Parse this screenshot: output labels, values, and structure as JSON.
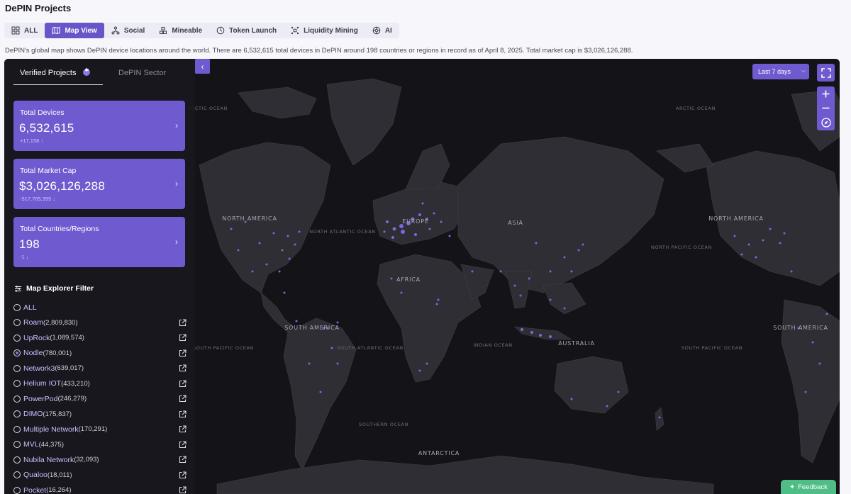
{
  "page": {
    "title": "DePIN Projects",
    "description": "DePIN's global map shows DePIN device locations around the world. There are 6,532,615 total devices in DePIN around 198 countries or regions in record as of April 8, 2025. Total market cap is $3,026,126,288."
  },
  "tabs": [
    {
      "label": "ALL",
      "icon": "grid-icon",
      "active": false
    },
    {
      "label": "Map View",
      "icon": "map-icon",
      "active": true
    },
    {
      "label": "Social",
      "icon": "network-icon",
      "active": false
    },
    {
      "label": "Mineable",
      "icon": "blocks-icon",
      "active": false
    },
    {
      "label": "Token Launch",
      "icon": "clock-icon",
      "active": false
    },
    {
      "label": "Liquidity Mining",
      "icon": "nodes-icon",
      "active": false
    },
    {
      "label": "AI",
      "icon": "ai-chip-icon",
      "active": false
    }
  ],
  "sidebar": {
    "tabs": [
      "Verified Projects",
      "DePIN Sector"
    ],
    "cards": [
      {
        "label": "Total Devices",
        "value": "6,532,615",
        "delta": "+17,158 ↑"
      },
      {
        "label": "Total Market Cap",
        "value": "$3,026,126,288",
        "delta": "-517,765,395 ↓"
      },
      {
        "label": "Total Countries/Regions",
        "value": "198",
        "delta": "-1 ↓"
      }
    ],
    "filter_title": "Map Explorer Filter",
    "filter_all_label": "ALL",
    "filters": [
      {
        "name": "Roam",
        "count": "(2,809,830)",
        "checked": false
      },
      {
        "name": "UpRock",
        "count": "(1,089,574)",
        "checked": false
      },
      {
        "name": "Nodle",
        "count": "(780,001)",
        "checked": true
      },
      {
        "name": "Network3",
        "count": "(639,017)",
        "checked": false
      },
      {
        "name": "Helium IOT",
        "count": "(433,210)",
        "checked": false
      },
      {
        "name": "PowerPod",
        "count": "(246,279)",
        "checked": false
      },
      {
        "name": "DIMO",
        "count": "(175,837)",
        "checked": false
      },
      {
        "name": "Multiple Network",
        "count": "(170,291)",
        "checked": false
      },
      {
        "name": "MVL",
        "count": "(44,375)",
        "checked": false
      },
      {
        "name": "Nubila Network",
        "count": "(32,093)",
        "checked": false
      },
      {
        "name": "Qualoo",
        "count": "(18,011)",
        "checked": false
      },
      {
        "name": "Pocket",
        "count": "(16,264)",
        "checked": false
      }
    ]
  },
  "map": {
    "range_label": "Last 7 days",
    "labels": {
      "arctic": "ARCTIC OCEAN",
      "north_america": "NORTH AMERICA",
      "south_america": "SOUTH AMERICA",
      "north_atlantic": "NORTH ATLANTIC OCEAN",
      "south_atlantic": "SOUTH ATLANTIC OCEAN",
      "north_pacific": "NORTH PACIFIC OCEAN",
      "south_pacific": "SOUTH PACIFIC OCEAN",
      "southern": "SOUTHERN OCEAN",
      "indian": "INDIAN OCEAN",
      "europe": "EUROPE",
      "asia": "ASIA",
      "africa": "AFRICA",
      "australia": "AUSTRALIA",
      "antarctica": "ANTARCTICA"
    }
  },
  "feedback_label": "Feedback",
  "colors": {
    "accent": "#6f5bcf",
    "map_bg": "#141418",
    "land": "#2e2e34",
    "device_dot": "#8b6cf0",
    "feedback": "#4ebd86"
  }
}
